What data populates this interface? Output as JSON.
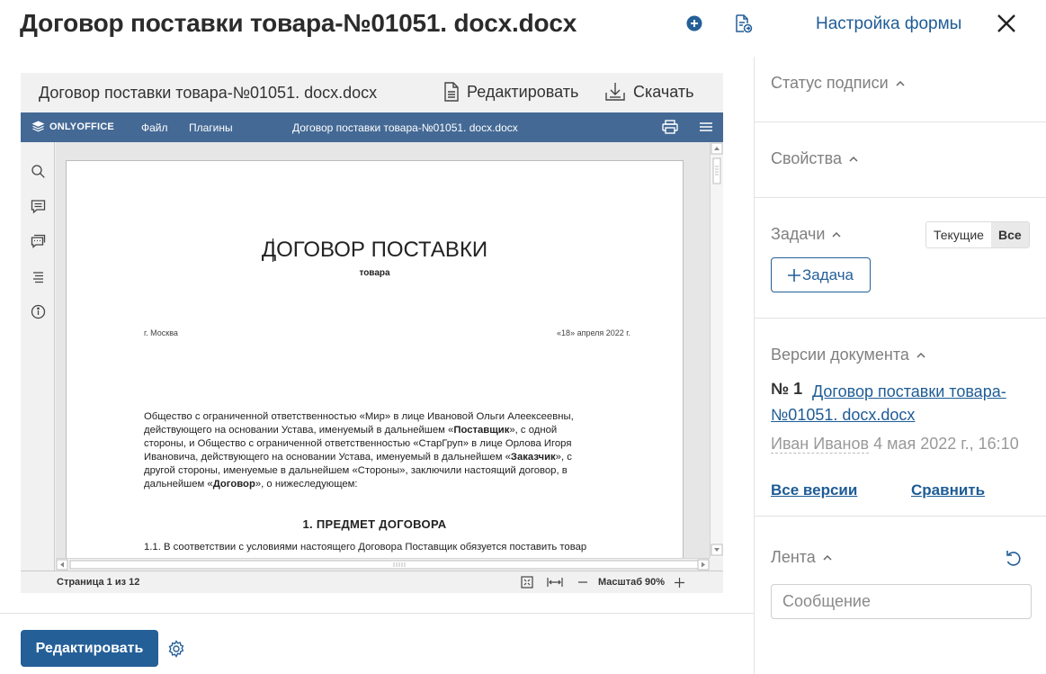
{
  "header": {
    "title": "Договор поставки товара-№01051. docx.docx",
    "form_settings": "Настройка формы",
    "icons": [
      "add-circle-icon",
      "document-export-icon",
      "close-icon"
    ]
  },
  "preview": {
    "file_name": "Договор поставки товара-№01051. docx.docx",
    "edit_label": "Редактировать",
    "download_label": "Скачать",
    "editor": {
      "brand": "ONLYOFFICE",
      "menu_file": "Файл",
      "menu_plugins": "Плагины",
      "doc_title": "Договор поставки товара-№01051. docx.docx",
      "page_info": "Страница 1 из 12",
      "zoom_label": "Масштаб 90%",
      "accent": "#446995"
    },
    "document": {
      "title": "ДОГОВОР ПОСТАВКИ",
      "subtitle": "товара",
      "city": "г. Москва",
      "date": "«18» апреля 2022 г.",
      "lines": [
        [
          {
            "t": "Общество с ограниченной ответственностью «Мир» в лице Ивановой Ольги Алеексеевны,"
          }
        ],
        [
          {
            "t": "действующего на основании Устава, именуемый в дальнейшем «"
          },
          {
            "t": "Поставщик",
            "b": true
          },
          {
            "t": "», с одной"
          }
        ],
        [
          {
            "t": "стороны, и Общество с ограниченной ответственностью «СтарГруп» в лице Орлова Игоря"
          }
        ],
        [
          {
            "t": "Ивановича, действующего на основании Устава, именуемый в дальнейшем «"
          },
          {
            "t": "Заказчик",
            "b": true
          },
          {
            "t": "», с"
          }
        ],
        [
          {
            "t": "другой стороны, именуемые в дальнейшем «Стороны», заключили настоящий договор, в"
          }
        ],
        [
          {
            "t": "дальнейшем «"
          },
          {
            "t": "Договор",
            "b": true
          },
          {
            "t": "», о нижеследующем:"
          }
        ]
      ],
      "section1": "1. ПРЕДМЕТ ДОГОВОРА",
      "clause": "1.1. В соответствии с условиями настоящего Договора Поставщик обязуется поставить товар"
    }
  },
  "footer": {
    "edit_button": "Редактировать"
  },
  "sidebar": {
    "signature_status": "Статус подписи",
    "properties": "Свойства",
    "tasks": "Задачи",
    "tasks_filter": [
      "Текущие",
      "Все"
    ],
    "tasks_filter_selected": "Все",
    "add_task": "Задача",
    "versions": "Версии документа",
    "version_number": "№ 1",
    "version_name": "Договор поставки товара-№01051. docx.docx",
    "version_author": "Иван Иванов",
    "version_date": "4 мая 2022 г., 16:10",
    "all_versions": "Все версии",
    "compare": "Сравнить",
    "feed": "Лента",
    "message_placeholder": "Сообщение"
  },
  "colors": {
    "primary": "#245f98",
    "link": "#1e5c96",
    "muted": "#808080"
  }
}
